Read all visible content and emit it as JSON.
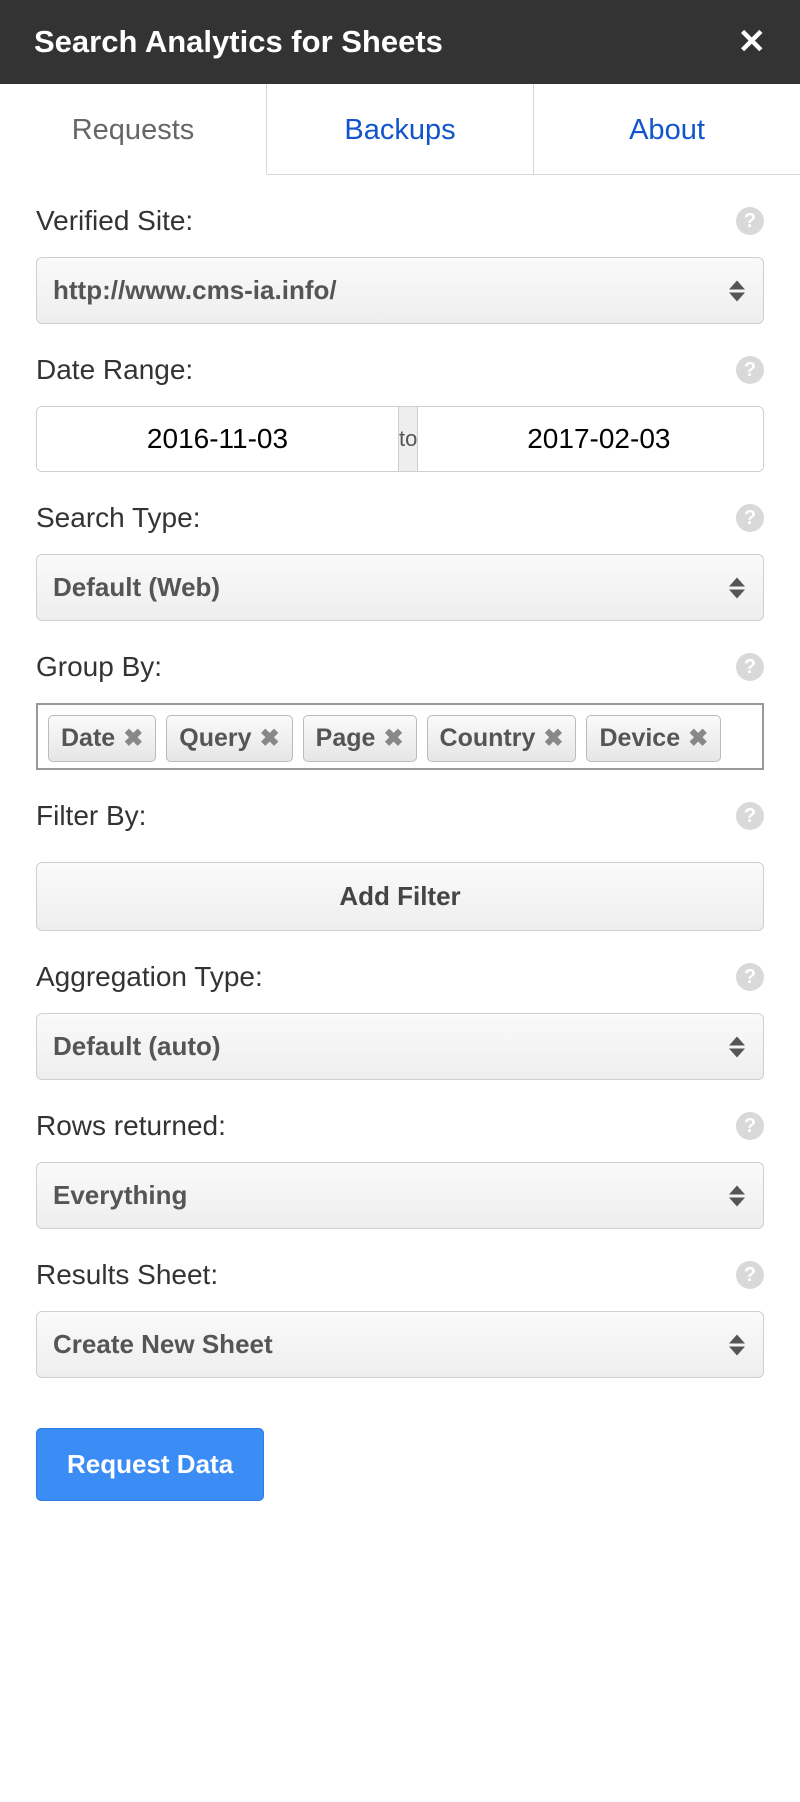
{
  "header": {
    "title": "Search Analytics for Sheets"
  },
  "tabs": [
    {
      "label": "Requests",
      "active": true
    },
    {
      "label": "Backups",
      "active": false
    },
    {
      "label": "About",
      "active": false
    }
  ],
  "form": {
    "verified_site": {
      "label": "Verified Site:",
      "value": "http://www.cms-ia.info/"
    },
    "date_range": {
      "label": "Date Range:",
      "from": "2016-11-03",
      "to_label": "to",
      "to": "2017-02-03"
    },
    "search_type": {
      "label": "Search Type:",
      "value": "Default (Web)"
    },
    "group_by": {
      "label": "Group By:",
      "chips": [
        "Date",
        "Query",
        "Page",
        "Country",
        "Device"
      ]
    },
    "filter_by": {
      "label": "Filter By:",
      "add_label": "Add Filter"
    },
    "aggregation_type": {
      "label": "Aggregation Type:",
      "value": "Default (auto)"
    },
    "rows_returned": {
      "label": "Rows returned:",
      "value": "Everything"
    },
    "results_sheet": {
      "label": "Results Sheet:",
      "value": "Create New Sheet"
    },
    "submit_label": "Request Data"
  }
}
